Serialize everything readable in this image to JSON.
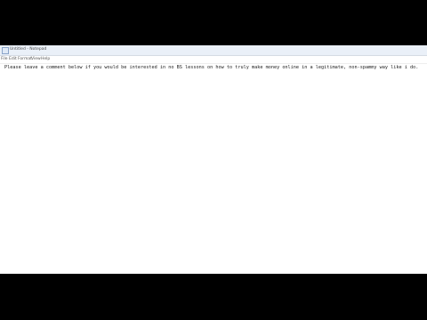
{
  "window": {
    "title": "Untitled - Notepad"
  },
  "menu": {
    "items": [
      "File",
      "Edit",
      "Format",
      "View",
      "Help"
    ]
  },
  "editor": {
    "content": "Please leave a comment below if you would be interested in no BS lessons on how to truly make money online in a legitimate, non-spammy way like i do."
  },
  "icons": {
    "app": "notepad-icon"
  },
  "colors": {
    "titlebar": "#eaf0f8",
    "background": "#000000",
    "editor": "#ffffff"
  }
}
